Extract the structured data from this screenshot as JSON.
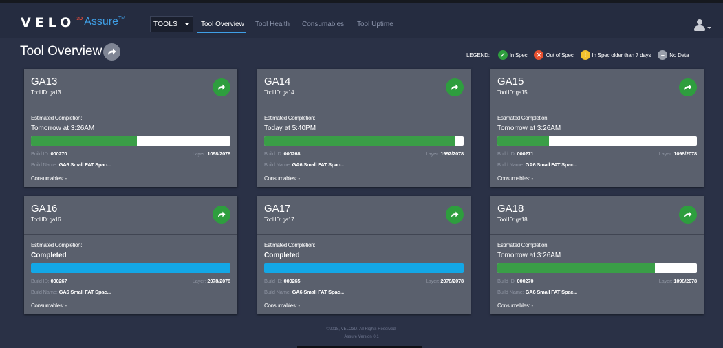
{
  "header": {
    "logo": {
      "velo": "VELO",
      "superscript": "3D",
      "assure": "Assure",
      "tm": "TM"
    },
    "tools_dropdown": "TOOLS",
    "tabs": [
      {
        "label": "Tool Overview",
        "active": true
      },
      {
        "label": "Tool Health",
        "active": false
      },
      {
        "label": "Consumables",
        "active": false
      },
      {
        "label": "Tool Uptime",
        "active": false
      }
    ],
    "user_icon": "user-icon"
  },
  "page": {
    "title": "Tool Overview",
    "title_icon": "share-arrow-icon"
  },
  "legend": {
    "label": "LEGEND:",
    "items": [
      {
        "label": "In Spec",
        "color": "#2e9e3e",
        "symbol": "✓"
      },
      {
        "label": "Out of Spec",
        "color": "#e8502f",
        "symbol": "✕"
      },
      {
        "label": "In Spec older than 7 days",
        "color": "#f2c12e",
        "symbol": "!"
      },
      {
        "label": "No Data",
        "color": "#9aa0ac",
        "symbol": "–"
      }
    ]
  },
  "cards": [
    {
      "name": "GA13",
      "tool_id_label": "Tool ID:",
      "tool_id": "ga13",
      "est_label": "Estimated Completion:",
      "est_value": "Tomorrow at 3:26AM",
      "completed": false,
      "progress": 0.53,
      "bar_color": "#3a9e47",
      "build_id_label": "Build ID:",
      "build_id": "000270",
      "layer_label": "Layer:",
      "layer": "1098/2078",
      "build_name_label": "Build Name:",
      "build_name": "GA6 Small FAT Spac...",
      "consumables": "Consumables: -"
    },
    {
      "name": "GA14",
      "tool_id_label": "Tool ID:",
      "tool_id": "ga14",
      "est_label": "Estimated Completion:",
      "est_value": "Today at 5:40PM",
      "completed": false,
      "progress": 0.96,
      "bar_color": "#3a9e47",
      "build_id_label": "Build ID:",
      "build_id": "000268",
      "layer_label": "Layer:",
      "layer": "1992/2078",
      "build_name_label": "Build Name:",
      "build_name": "GA6 Small FAT Spac...",
      "consumables": "Consumables: -"
    },
    {
      "name": "GA15",
      "tool_id_label": "Tool ID:",
      "tool_id": "ga15",
      "est_label": "Estimated Completion:",
      "est_value": "Tomorrow at 3:26AM",
      "completed": false,
      "progress": 0.26,
      "bar_color": "#3a9e47",
      "build_id_label": "Build ID:",
      "build_id": "000271",
      "layer_label": "Layer:",
      "layer": "1098/2078",
      "build_name_label": "Build Name:",
      "build_name": "GA6 Small FAT Spac...",
      "consumables": "Consumables: -"
    },
    {
      "name": "GA16",
      "tool_id_label": "Tool ID:",
      "tool_id": "ga16",
      "est_label": "Estimated Completion:",
      "est_value": "Completed",
      "completed": true,
      "progress": 1.0,
      "bar_color": "#13a7e6",
      "build_id_label": "Build ID:",
      "build_id": "000267",
      "layer_label": "Layer:",
      "layer": "2078/2078",
      "build_name_label": "Build Name:",
      "build_name": "GA6 Small FAT Spac...",
      "consumables": "Consumables: -"
    },
    {
      "name": "GA17",
      "tool_id_label": "Tool ID:",
      "tool_id": "ga17",
      "est_label": "Estimated Completion:",
      "est_value": "Completed",
      "completed": true,
      "progress": 1.0,
      "bar_color": "#13a7e6",
      "build_id_label": "Build ID:",
      "build_id": "000265",
      "layer_label": "Layer:",
      "layer": "2078/2078",
      "build_name_label": "Build Name:",
      "build_name": "GA6 Small FAT Spac...",
      "consumables": "Consumables: -"
    },
    {
      "name": "GA18",
      "tool_id_label": "Tool ID:",
      "tool_id": "ga18",
      "est_label": "Estimated Completion:",
      "est_value": "Tomorrow at 3:26AM",
      "completed": false,
      "progress": 0.79,
      "bar_color": "#3a9e47",
      "build_id_label": "Build ID:",
      "build_id": "000270",
      "layer_label": "Layer:",
      "layer": "1098/2078",
      "build_name_label": "Build Name:",
      "build_name": "GA6 Small FAT Spac...",
      "consumables": "Consumables: -"
    }
  ],
  "footer": {
    "copyright": "©2018, VELO3D. All Rights Reserved.",
    "version": "Assure Version 0.1"
  }
}
